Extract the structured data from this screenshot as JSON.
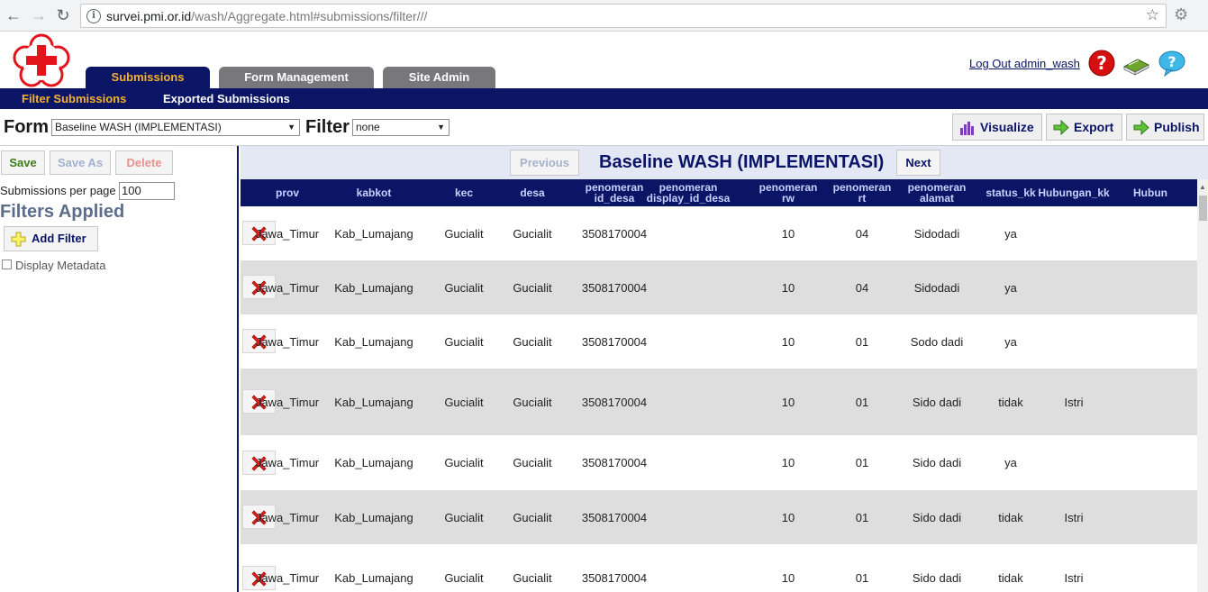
{
  "browser": {
    "url_host": "survei.pmi.or.id",
    "url_path": "/wash/Aggregate.html#submissions/filter///",
    "back_icon": "back-arrow-icon",
    "forward_icon": "forward-arrow-icon",
    "reload_icon": "reload-icon",
    "star_icon": "bookmark-star-icon"
  },
  "header": {
    "tabs": [
      {
        "label": "Submissions",
        "active": true
      },
      {
        "label": "Form Management",
        "active": false
      },
      {
        "label": "Site Admin",
        "active": false
      }
    ],
    "logout_label": "Log Out admin_wash",
    "subnav": {
      "active": "Filter Submissions",
      "other": "Exported Submissions"
    },
    "colors": {
      "navy": "#0b1566",
      "orange": "#f6b22a",
      "gray_tab": "#77777c",
      "red_cross": "#e3141b"
    }
  },
  "formbar": {
    "form_label": "Form",
    "form_value": "Baseline WASH (IMPLEMENTASI)",
    "filter_label": "Filter",
    "filter_value": "none",
    "visualize_label": "Visualize",
    "export_label": "Export",
    "publish_label": "Publish"
  },
  "left": {
    "save_label": "Save",
    "save_as_label": "Save As",
    "delete_label": "Delete",
    "per_page_label": "Submissions per page",
    "per_page_value": "100",
    "filters_title": "Filters Applied",
    "add_filter_label": "Add Filter",
    "display_metadata_label": "Display Metadata"
  },
  "results": {
    "previous_label": "Previous",
    "next_label": "Next",
    "title": "Baseline WASH (IMPLEMENTASI)",
    "columns": [
      {
        "l1": "prov",
        "l2": ""
      },
      {
        "l1": "kabkot",
        "l2": ""
      },
      {
        "l1": "kec",
        "l2": ""
      },
      {
        "l1": "desa",
        "l2": ""
      },
      {
        "l1": "penomeran",
        "l2": "id_desa"
      },
      {
        "l1": "penomeran",
        "l2": "display_id_desa"
      },
      {
        "l1": "penomeran",
        "l2": "rw"
      },
      {
        "l1": "penomeran",
        "l2": "rt"
      },
      {
        "l1": "penomeran",
        "l2": "alamat"
      },
      {
        "l1": "status_kk",
        "l2": ""
      },
      {
        "l1": "Hubungan_kk",
        "l2": ""
      },
      {
        "l1": "Hubun",
        "l2": ""
      }
    ],
    "rows": [
      [
        "Jawa_Timur",
        "Kab_Lumajang",
        "Gucialit",
        "Gucialit",
        "3508170004",
        "",
        "10",
        "04",
        "Sidodadi",
        "ya",
        "",
        ""
      ],
      [
        "Jawa_Timur",
        "Kab_Lumajang",
        "Gucialit",
        "Gucialit",
        "3508170004",
        "",
        "10",
        "04",
        "Sidodadi",
        "ya",
        "",
        ""
      ],
      [
        "Jawa_Timur",
        "Kab_Lumajang",
        "Gucialit",
        "Gucialit",
        "3508170004",
        "",
        "10",
        "01",
        "Sodo dadi",
        "ya",
        "",
        ""
      ],
      [
        "Jawa_Timur",
        "Kab_Lumajang",
        "Gucialit",
        "Gucialit",
        "3508170004",
        "",
        "10",
        "01",
        "Sido dadi",
        "tidak",
        "Istri",
        ""
      ],
      [
        "Jawa_Timur",
        "Kab_Lumajang",
        "Gucialit",
        "Gucialit",
        "3508170004",
        "",
        "10",
        "01",
        "Sido dadi",
        "ya",
        "",
        ""
      ],
      [
        "Jawa_Timur",
        "Kab_Lumajang",
        "Gucialit",
        "Gucialit",
        "3508170004",
        "",
        "10",
        "01",
        "Sido dadi",
        "tidak",
        "Istri",
        ""
      ],
      [
        "Jawa_Timur",
        "Kab_Lumajang",
        "Gucialit",
        "Gucialit",
        "3508170004",
        "",
        "10",
        "01",
        "Sido dadi",
        "tidak",
        "Istri",
        ""
      ]
    ]
  }
}
